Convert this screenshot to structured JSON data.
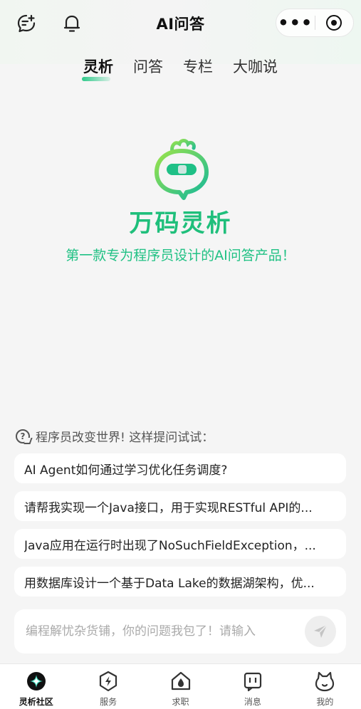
{
  "header": {
    "title": "AI问答",
    "left_icons": [
      "chat-plus-icon",
      "bell-icon"
    ],
    "capsule": {
      "more_glyph": "•••",
      "close_icon": "target-icon"
    }
  },
  "tabs": [
    {
      "label": "灵析",
      "active": true
    },
    {
      "label": "问答",
      "active": false
    },
    {
      "label": "专栏",
      "active": false
    },
    {
      "label": "大咖说",
      "active": false
    }
  ],
  "hero": {
    "brand": "万码灵析",
    "slogan": "第一款专为程序员设计的AI问答产品！",
    "accent_color": "#1fbf7b"
  },
  "suggestions": {
    "header": "程序员改变世界! 这样提问试试：",
    "items": [
      "AI Agent如何通过学习优化任务调度?",
      "请帮我实现一个Java接口，用于实现RESTful API的...",
      "Java应用在运行时出现了NoSuchFieldException，...",
      "用数据库设计一个基于Data Lake的数据湖架构，优..."
    ]
  },
  "input": {
    "value": "",
    "placeholder": "编程解忧杂货铺，你的问题我包了！请输入"
  },
  "tabbar": [
    {
      "label": "灵析社区",
      "icon": "sparkle-circle-icon",
      "active": true
    },
    {
      "label": "服务",
      "icon": "lightning-badge-icon",
      "active": false
    },
    {
      "label": "求职",
      "icon": "house-drop-icon",
      "active": false
    },
    {
      "label": "消息",
      "icon": "message-box-icon",
      "active": false
    },
    {
      "label": "我的",
      "icon": "cat-face-icon",
      "active": false
    }
  ]
}
